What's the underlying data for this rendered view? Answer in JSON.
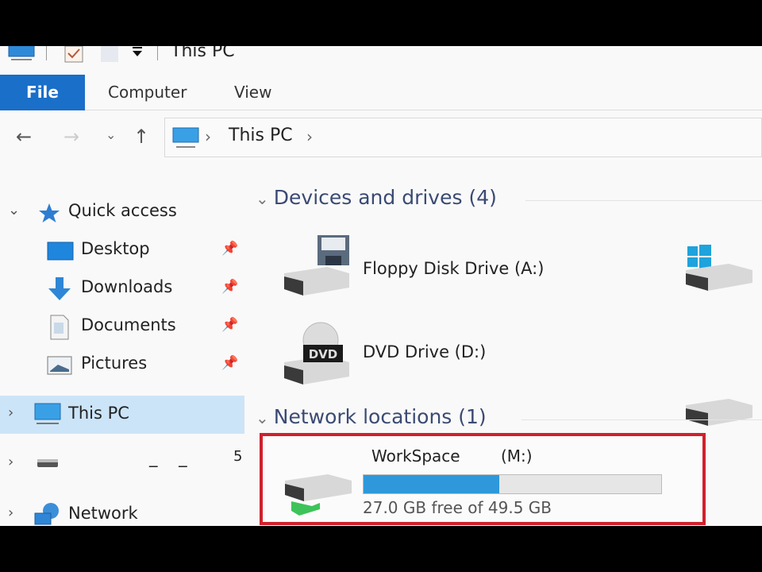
{
  "window": {
    "title": "This PC"
  },
  "quick_access_toolbar": {
    "icons": [
      "computer-icon",
      "properties-check-icon",
      "new-folder-icon",
      "customize-dropdown-icon"
    ]
  },
  "ribbon": {
    "tabs": [
      {
        "label": "File",
        "active": true
      },
      {
        "label": "Computer",
        "active": false
      },
      {
        "label": "View",
        "active": false
      }
    ],
    "accent": "#1a6fc9"
  },
  "navigation": {
    "back": "←",
    "forward": "→",
    "recent": "⌄",
    "up": "↑",
    "address": {
      "segments": [
        "This PC"
      ],
      "separator": "›"
    }
  },
  "sidebar": {
    "quick_access": {
      "label": "Quick access",
      "expanded": true
    },
    "pinned": [
      {
        "label": "Desktop",
        "icon": "desktop-icon"
      },
      {
        "label": "Downloads",
        "icon": "downloads-icon"
      },
      {
        "label": "Documents",
        "icon": "documents-icon"
      },
      {
        "label": "Pictures",
        "icon": "pictures-icon"
      }
    ],
    "this_pc": {
      "label": "This PC",
      "selected": true
    },
    "unnamed_drive": {
      "label": "_ _",
      "suffix": "5"
    },
    "network": {
      "label": "Network"
    }
  },
  "content": {
    "groups": [
      {
        "title": "Devices and drives (4)",
        "items": [
          {
            "name": "Floppy Disk Drive (A:)",
            "icon": "floppy-drive-icon"
          },
          {
            "name": "",
            "icon": "windows-drive-icon"
          },
          {
            "name": "DVD Drive (D:)",
            "icon": "dvd-drive-icon"
          },
          {
            "name": "",
            "icon": "hard-drive-icon"
          }
        ]
      },
      {
        "title": "Network locations (1)",
        "items": [
          {
            "name": "WorkSpace",
            "letter": "(M:)",
            "free_text": "27.0 GB free of 49.5 GB",
            "used_fraction": 0.455,
            "bar_color": "#2f98da",
            "highlight_color": "#d0202c"
          }
        ]
      }
    ]
  }
}
